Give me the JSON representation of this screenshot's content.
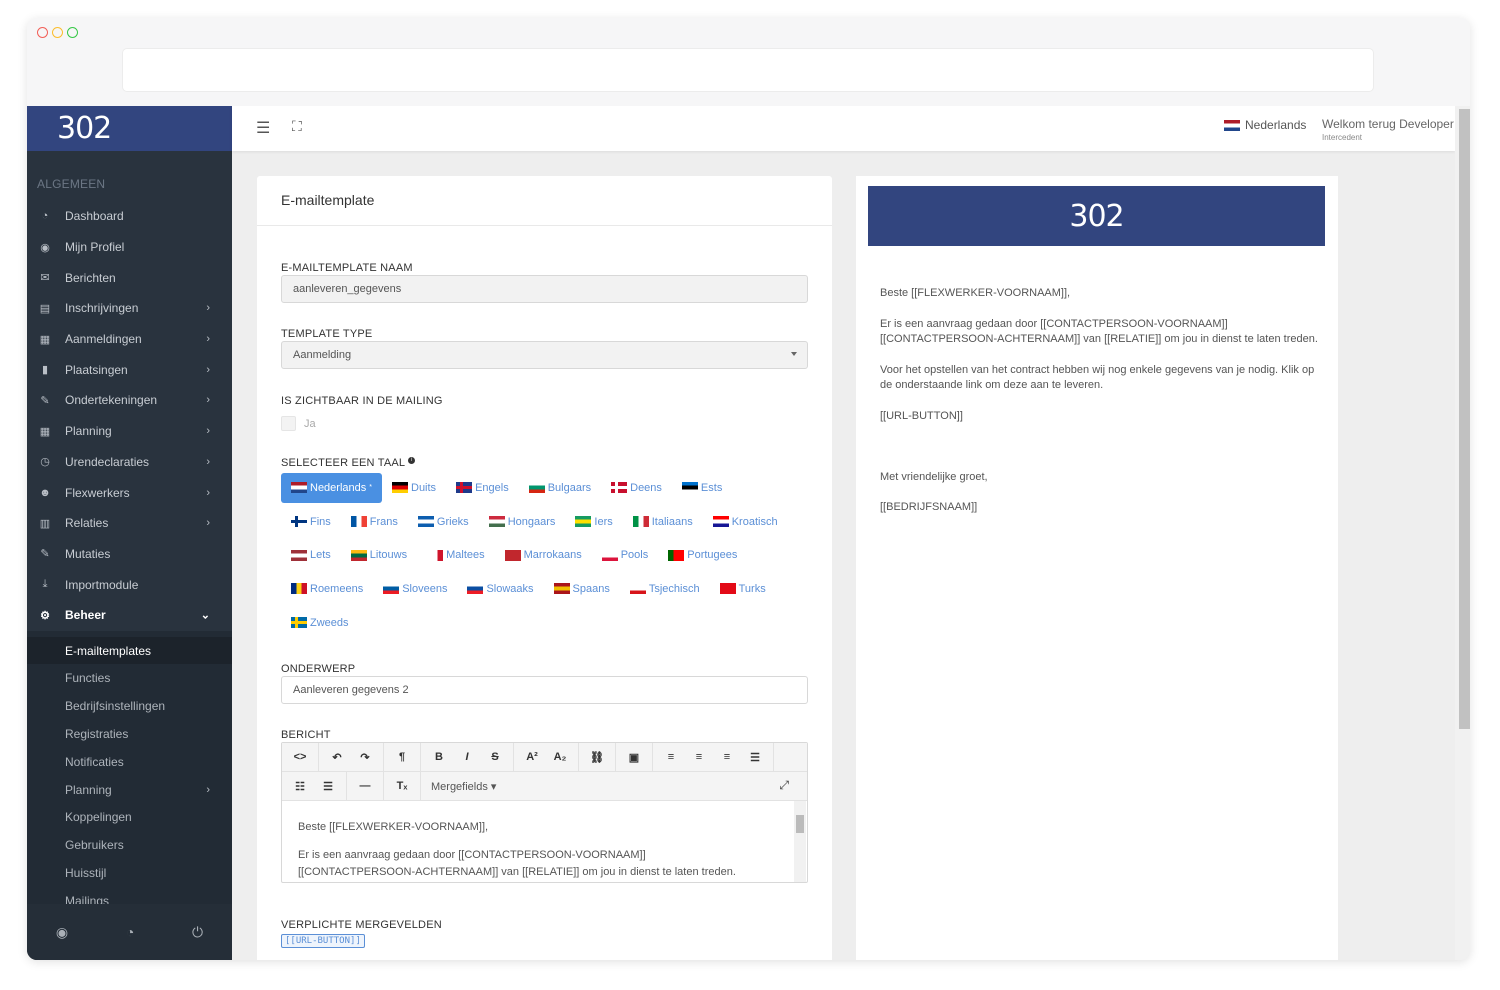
{
  "brand": {
    "logo": "302",
    "colors": {
      "primary": "#32457f",
      "sidebar": "#29333e",
      "accent": "#4a90e2",
      "link": "#5b8fd6"
    }
  },
  "sidebar": {
    "section": "ALGEMEEN",
    "items": [
      {
        "label": "Dashboard",
        "icon": "dashboard-icon",
        "chevron": false
      },
      {
        "label": "Mijn Profiel",
        "icon": "user-circle-icon",
        "chevron": false
      },
      {
        "label": "Berichten",
        "icon": "envelope-icon",
        "chevron": false
      },
      {
        "label": "Inschrijvingen",
        "icon": "id-card-icon",
        "chevron": true
      },
      {
        "label": "Aanmeldingen",
        "icon": "table-icon",
        "chevron": true
      },
      {
        "label": "Plaatsingen",
        "icon": "bookmark-icon",
        "chevron": true
      },
      {
        "label": "Ondertekeningen",
        "icon": "pen-icon",
        "chevron": true
      },
      {
        "label": "Planning",
        "icon": "calendar-icon",
        "chevron": true
      },
      {
        "label": "Urendeclaraties",
        "icon": "clock-icon",
        "chevron": true
      },
      {
        "label": "Flexwerkers",
        "icon": "users-icon",
        "chevron": true
      },
      {
        "label": "Relaties",
        "icon": "building-icon",
        "chevron": true
      },
      {
        "label": "Mutaties",
        "icon": "edit-icon",
        "chevron": false
      },
      {
        "label": "Importmodule",
        "icon": "download-icon",
        "chevron": false
      },
      {
        "label": "Beheer",
        "icon": "gear-icon",
        "chevron": true
      }
    ],
    "sub_items": [
      "E-mailtemplates",
      "Functies",
      "Bedrijfsinstellingen",
      "Registraties",
      "Notificaties",
      "Planning",
      "Koppelingen",
      "Gebruikers",
      "Huisstijl",
      "Mailings"
    ],
    "footer_icons": [
      "user-circle-icon",
      "dashboard-icon",
      "power-icon"
    ]
  },
  "topbar": {
    "language": "Nederlands",
    "welcome": "Welkom terug Developer",
    "role": "Intercedent"
  },
  "form": {
    "title": "E-mailtemplate",
    "name_label": "E-MAILTEMPLATE NAAM",
    "name_value": "aanleveren_gegevens",
    "type_label": "TEMPLATE TYPE",
    "type_value": "Aanmelding",
    "visible_label": "IS ZICHTBAAR IN DE MAILING",
    "visible_option": "Ja",
    "lang_label": "SELECTEER EEN TAAL",
    "languages": [
      [
        "Nederlands",
        "Duits",
        "Engels",
        "Bulgaars",
        "Deens",
        "Ests"
      ],
      [
        "Fins",
        "Frans",
        "Grieks",
        "Hongaars",
        "Iers",
        "Italiaans",
        "Kroatisch"
      ],
      [
        "Lets",
        "Litouws",
        "Maltees",
        "Marrokaans",
        "Pools",
        "Portugees"
      ],
      [
        "Roemeens",
        "Sloveens",
        "Slowaaks",
        "Spaans",
        "Tsjechisch",
        "Turks"
      ],
      [
        "Zweeds"
      ]
    ],
    "selected_language_mark": "*",
    "subject_label": "ONDERWERP",
    "subject_value": "Aanleveren gegevens 2",
    "message_label": "BERICHT",
    "mergefields_label": "Mergefields",
    "editor_text": [
      "Beste [[FLEXWERKER-VOORNAAM]],",
      "Er is een aanvraag gedaan door [[CONTACTPERSOON-VOORNAAM]] [[CONTACTPERSOON-ACHTERNAAM]] van [[RELATIE]] om jou in dienst te laten treden."
    ],
    "required_label": "VERPLICHTE MERGEVELDEN",
    "required_tag": "[[URL-BUTTON]]"
  },
  "preview": {
    "logo": "302",
    "paragraphs": [
      "Beste [[FLEXWERKER-VOORNAAM]],",
      "Er is een aanvraag gedaan door [[CONTACTPERSOON-VOORNAAM]] [[CONTACTPERSOON-ACHTERNAAM]] van [[RELATIE]] om jou in dienst te laten treden.",
      "Voor het opstellen van het contract hebben wij nog enkele gegevens van je nodig. Klik op de onderstaande link om deze aan te leveren.",
      "[[URL-BUTTON]]",
      "",
      "Met vriendelijke groet,",
      "[[BEDRIJFSNAAM]]"
    ]
  }
}
